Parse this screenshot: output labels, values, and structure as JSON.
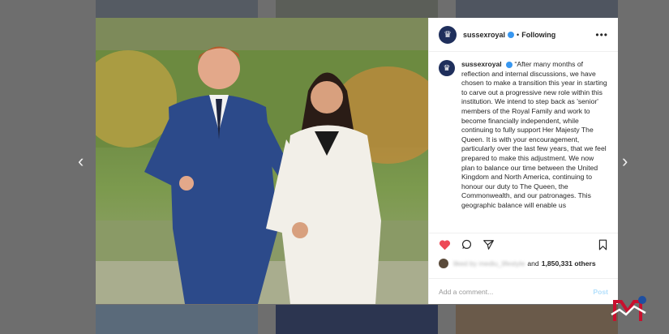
{
  "post": {
    "username": "sussexroyal",
    "follow_label": "Following",
    "more_label": "•••",
    "caption": "“After many months of reflection and internal discussions, we have chosen to make a transition this year in starting to carve out a progressive new role within this institution. We intend to step back as 'senior' members of the Royal Family and work to become financially independent, while continuing to fully support Her Majesty The Queen. It is with your encouragement, particularly over the last few years, that we feel prepared to make this adjustment. We now plan to balance our time between the United Kingdom and North America, continuing to honour our duty to The Queen, the Commonwealth, and our patronages. This geographic balance will enable us",
    "liked_by_blurred": "liked by mediu_lifestyle",
    "liked_and_label": "and",
    "others_count": "1,850,331 others",
    "comment_placeholder": "Add a comment...",
    "post_label": "Post"
  },
  "nav": {
    "prev": "‹",
    "next": "›"
  },
  "colors": {
    "accent": "#3897f0",
    "heart": "#ed4956",
    "avatar": "#1f2f5c"
  },
  "icons": [
    "heart-icon",
    "comment-icon",
    "share-icon",
    "bookmark-icon",
    "verified-icon"
  ]
}
